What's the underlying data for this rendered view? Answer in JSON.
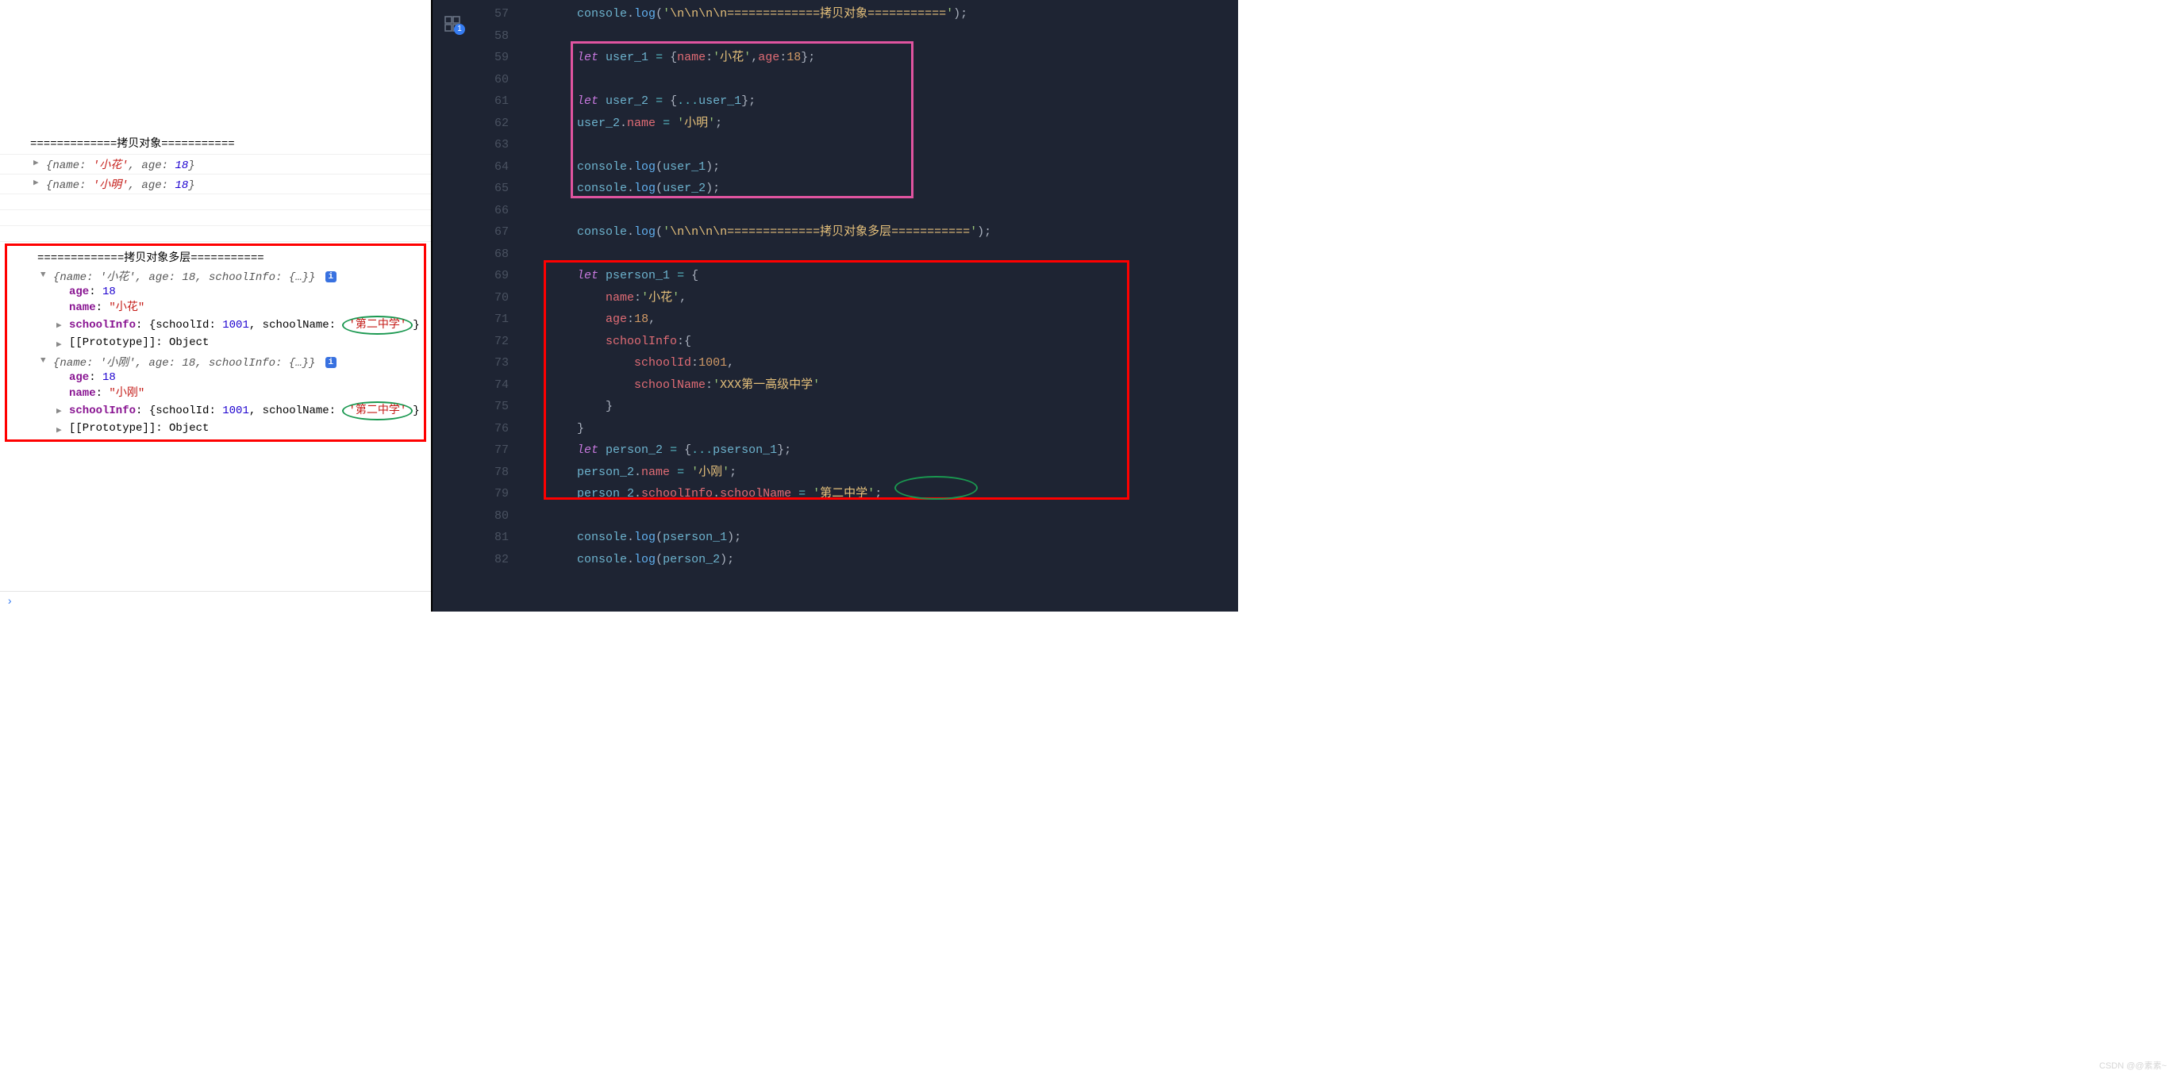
{
  "console": {
    "section1_header": "=============拷贝对象===========",
    "obj1": {
      "summary_pre": "{name: ",
      "name": "'小花'",
      "age_label": ", age: ",
      "age": "18",
      "suffix": "}"
    },
    "obj2": {
      "summary_pre": "{name: ",
      "name": "'小明'",
      "age_label": ", age: ",
      "age": "18",
      "suffix": "}"
    },
    "section2_header": "=============拷贝对象多层===========",
    "exp1": {
      "summary": "{name: '小花', age: 18, schoolInfo: {…}}",
      "age_k": "age",
      "age_v": "18",
      "name_k": "name",
      "name_v": "\"小花\"",
      "school_k": "schoolInfo",
      "school_v_pre": "{schoolId: ",
      "school_id": "1001",
      "school_v_mid": ", schoolName: ",
      "school_name": "'第二中学'",
      "school_v_suf": "}",
      "proto_k": "[[Prototype]]",
      "proto_v": "Object"
    },
    "exp2": {
      "summary": "{name: '小刚', age: 18, schoolInfo: {…}}",
      "age_k": "age",
      "age_v": "18",
      "name_k": "name",
      "name_v": "\"小刚\"",
      "school_k": "schoolInfo",
      "school_v_pre": "{schoolId: ",
      "school_id": "1001",
      "school_v_mid": ", schoolName: ",
      "school_name": "'第二中学'",
      "school_v_suf": "}",
      "proto_k": "[[Prototype]]",
      "proto_v": "Object"
    },
    "info_badge": "i",
    "prompt": "›"
  },
  "activity": {
    "badge": "1"
  },
  "editor": {
    "line_start": 57,
    "line_end": 82,
    "lines": [
      "        console.log('\\n\\n\\n\\n=============拷贝对象===========');",
      "",
      "        let user_1 = {name:'小花',age:18};",
      "",
      "        let user_2 = {...user_1};",
      "        user_2.name = '小明';",
      "",
      "        console.log(user_1);",
      "        console.log(user_2);",
      "",
      "        console.log('\\n\\n\\n\\n=============拷贝对象多层===========');",
      "",
      "        let pserson_1 = {",
      "            name:'小花',",
      "            age:18,",
      "            schoolInfo:{",
      "                schoolId:1001,",
      "                schoolName:'XXX第一高级中学'",
      "            }",
      "        }",
      "        let person_2 = {...pserson_1};",
      "        person_2.name = '小刚';",
      "        person_2.schoolInfo.schoolName = '第二中学';",
      "",
      "        console.log(pserson_1);",
      "        console.log(person_2);"
    ]
  },
  "watermark": "CSDN @@素素~"
}
